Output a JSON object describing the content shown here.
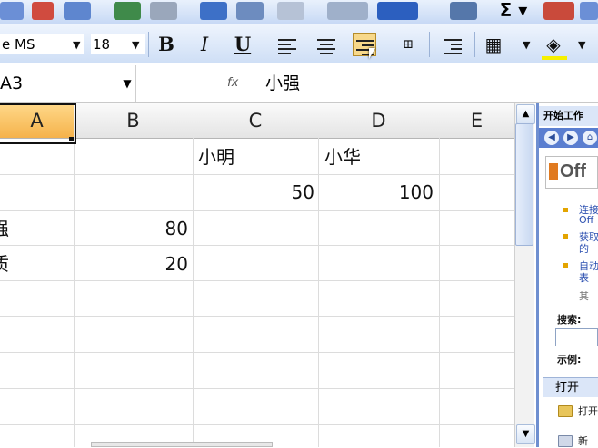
{
  "toolbar_format": {
    "font_name": "e MS",
    "font_size": "18",
    "bold": "B",
    "italic": "I",
    "underline": "U"
  },
  "formula_bar": {
    "name_box": "A3",
    "fx": "fx",
    "content": "小强"
  },
  "grid": {
    "columns": [
      "A",
      "B",
      "C",
      "D",
      "E"
    ],
    "selected_column": "A",
    "cells": {
      "C1": "小明",
      "D1": "小华",
      "C2": "50",
      "D2": "100",
      "A3": "强",
      "B3": "80",
      "A4": "质",
      "B4": "20"
    }
  },
  "task_pane": {
    "title": "开始工作",
    "logo_text": "Off",
    "links": [
      "连接",
      "Off",
      "获取",
      "的",
      "自动",
      "表"
    ],
    "extra": "其",
    "search_label": "搜索:",
    "example_label": "示例:",
    "open_header": "打开",
    "open_item1": "打开",
    "open_item2": "新"
  }
}
